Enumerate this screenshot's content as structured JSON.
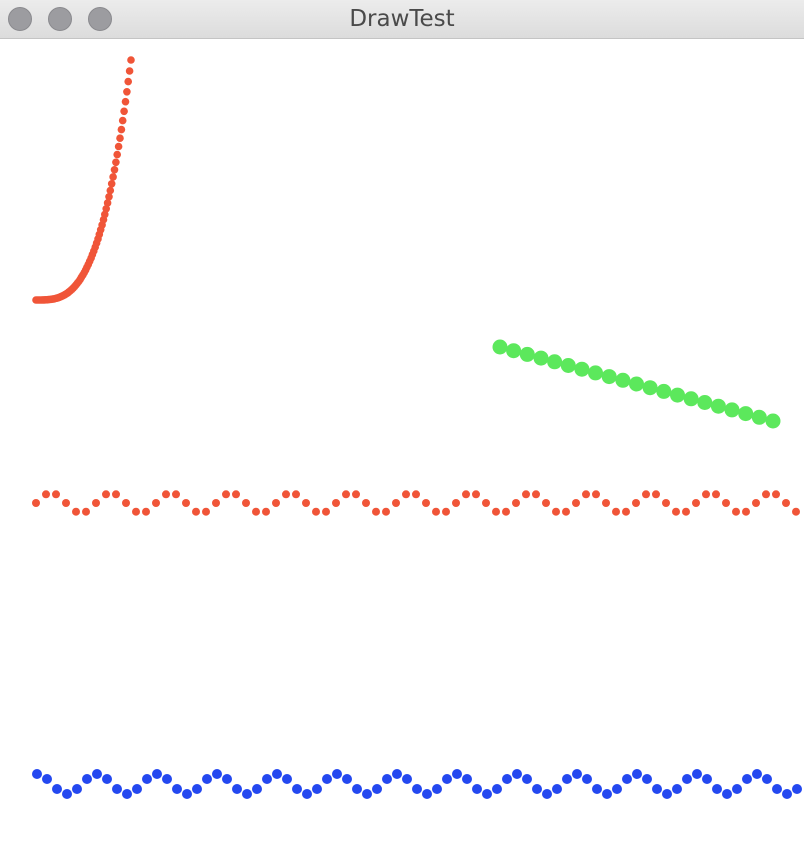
{
  "window": {
    "title": "DrawTest",
    "buttons": [
      "close",
      "minimize",
      "zoom"
    ],
    "button_color": "#9c9ca0"
  },
  "canvas": {
    "background": "#ffffff",
    "curves": [
      {
        "name": "exponential",
        "color": "#f05538"
      },
      {
        "name": "descending-line",
        "color": "#5ce85c"
      },
      {
        "name": "red-sine-wave",
        "color": "#f05538"
      },
      {
        "name": "blue-sine-wave",
        "color": "#2448f0"
      }
    ]
  }
}
